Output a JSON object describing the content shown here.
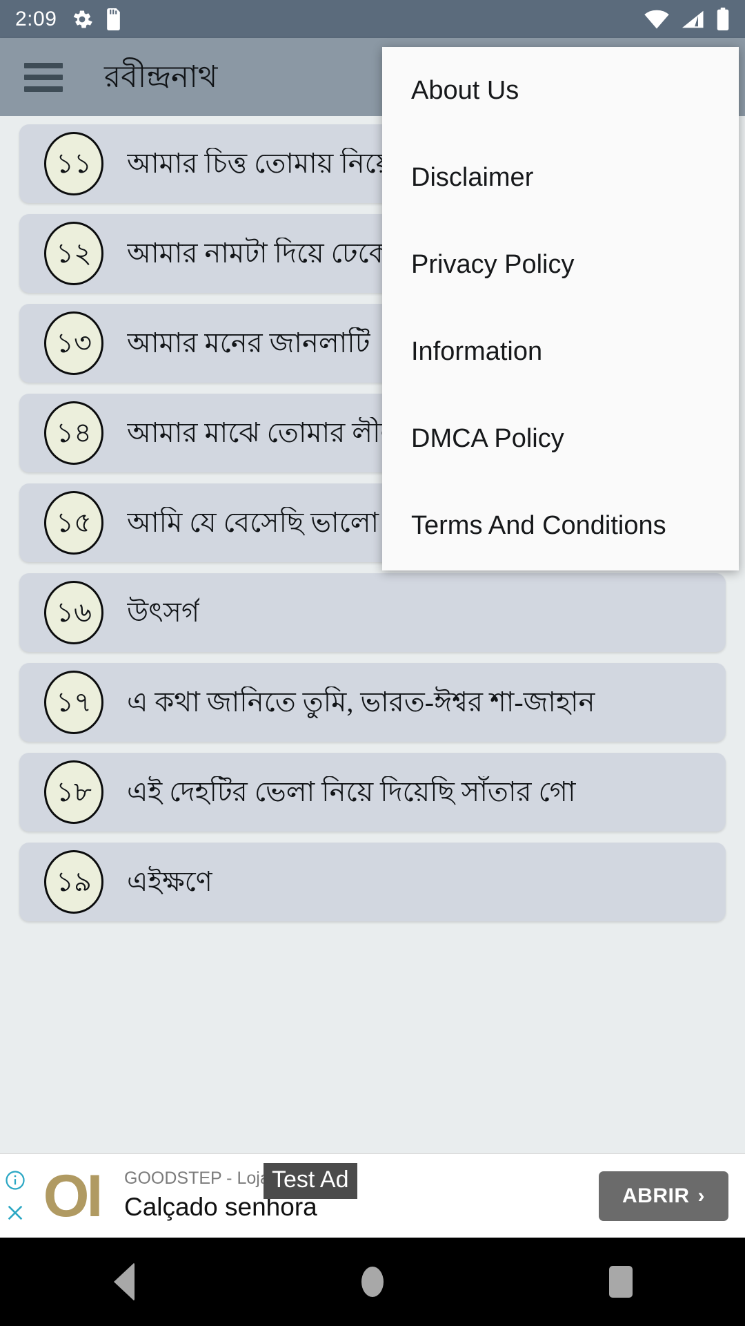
{
  "status_bar": {
    "time": "2:09",
    "left_icons": [
      "gear-icon",
      "sd-card-icon"
    ],
    "right_icons": [
      "wifi-icon",
      "cellular-signal-icon",
      "battery-icon"
    ],
    "background_color": "#5b6b7c"
  },
  "app_bar": {
    "menu_icon": "hamburger-menu-icon",
    "title": "রবীন্দ্রনাথ",
    "background_color": "#8b98a4"
  },
  "overflow_menu": {
    "items": [
      {
        "label": "About Us"
      },
      {
        "label": "Disclaimer"
      },
      {
        "label": "Privacy Policy"
      },
      {
        "label": "Information"
      },
      {
        "label": "DMCA Policy"
      },
      {
        "label": "Terms And Conditions"
      }
    ],
    "background_color": "#fafafa"
  },
  "list": {
    "items": [
      {
        "number": "১১",
        "title": "আমার চিত্ত তোমায় নিয়ে"
      },
      {
        "number": "১২",
        "title": "আমার নামটা দিয়ে ঢেকে"
      },
      {
        "number": "১৩",
        "title": "আমার মনের জানলাটি"
      },
      {
        "number": "১৪",
        "title": "আমার মাঝে তোমার লীলা"
      },
      {
        "number": "১৫",
        "title": "আমি যে বেসেছি ভালো এই জগতেরে"
      },
      {
        "number": "১৬",
        "title": "উৎসর্গ"
      },
      {
        "number": "১৭",
        "title": "এ কথা জানিতে তুমি, ভারত-ঈশ্বর শা-জাহান"
      },
      {
        "number": "১৮",
        "title": "এই দেহটির ভেলা নিয়ে দিয়েছি সাঁতার গো"
      },
      {
        "number": "১৯",
        "title": "এইক্ষণে"
      }
    ],
    "row_color": "#d2d7e0",
    "badge_color": "#ecefdc"
  },
  "ad": {
    "info_icon": "ad-info-icon",
    "close_icon": "ad-close-icon",
    "logo_text": "OI",
    "advertiser": "GOODSTEP - Loja Onli",
    "headline": "Calçado senhora",
    "badge": "Test Ad",
    "cta_label": "ABRIR",
    "cta_chevron": "›",
    "cta_color": "#6b6b6b"
  },
  "nav_bar": {
    "back": "back-triangle-icon",
    "home": "home-circle-icon",
    "recents": "recents-square-icon",
    "background_color": "#000000"
  }
}
